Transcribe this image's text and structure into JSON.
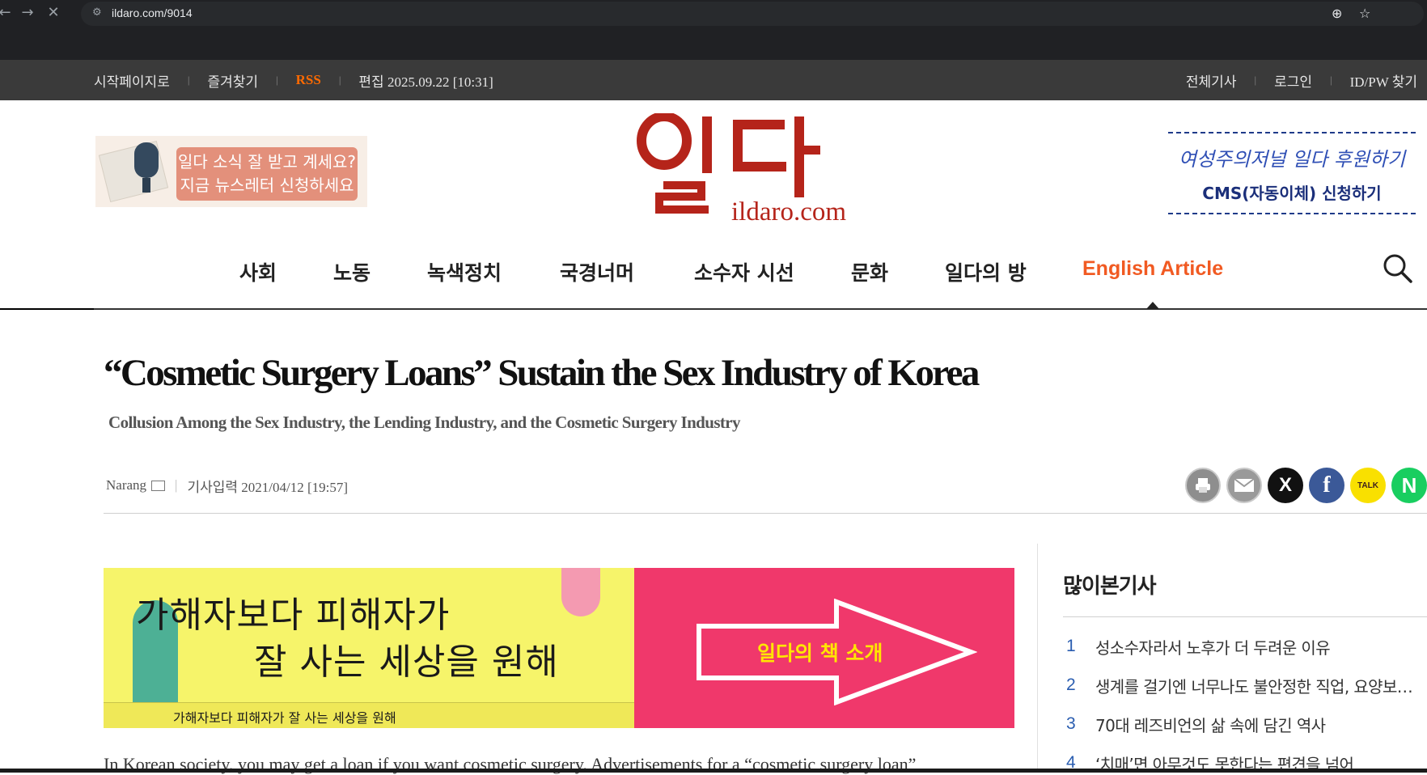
{
  "browser": {
    "url": "ildaro.com/9014"
  },
  "util_bar": {
    "left": [
      "시작페이지로",
      "즐겨찾기",
      "RSS",
      "편집 2025.09.22 [10:31]"
    ],
    "right": [
      "전체기사",
      "로그인",
      "ID/PW 찾기"
    ],
    "sep": "|"
  },
  "header": {
    "newsletter_line1": "일다 소식 잘 받고 계세요?",
    "newsletter_line2": "지금 뉴스레터 신청하세요~",
    "logo_domain": "ildaro.com",
    "cms_line1": "여성주의저널 일다 후원하기",
    "cms_line2": "CMS(자동이체) 신청하기",
    "colors": {
      "logo_red": "#b5241a",
      "accent": "#f15a22"
    }
  },
  "nav": {
    "items": [
      "사회",
      "노동",
      "녹색정치",
      "국경너머",
      "소수자 시선",
      "문화",
      "일다의 방",
      "English Article"
    ],
    "active_index": 7
  },
  "article": {
    "title": "“Cosmetic Surgery Loans” Sustain the Sex Industry of Korea",
    "subtitle": "Collusion Among the Sex Industry, the Lending Industry, and the Cosmetic Surgery Industry",
    "author": "Narang",
    "date_label": "기사입력 2021/04/12 [19:57]",
    "share": [
      "print-icon",
      "mail-icon",
      "x-icon",
      "facebook-icon",
      "kakaotalk-icon",
      "naver-icon"
    ],
    "share_labels": {
      "x": "X",
      "facebook": "f",
      "talk": "TALK",
      "naver": "N"
    },
    "body_start": "In Korean society, you may get a loan if you want cosmetic surgery. Advertisements for a “cosmetic surgery loan”"
  },
  "book_banner": {
    "title_line1": "가해자보다 피해자가",
    "title_line2": "잘 사는 세상을 원해",
    "spine": "가해자보다 피해자가 잘 사는 세상을 원해",
    "cta": "일다의 책 소개"
  },
  "sidebar": {
    "popular_title": "많이본기사",
    "items": [
      {
        "num": "1",
        "title": "성소수자라서 노후가 더 두려운 이유"
      },
      {
        "num": "2",
        "title": "생계를 걸기엔 너무나도 불안정한 직업, 요양보호사"
      },
      {
        "num": "3",
        "title": "70대 레즈비언의 삶 속에 담긴 역사"
      },
      {
        "num": "4",
        "title": "‘치매’면 아무것도 못한다는 편견을 넘어"
      }
    ]
  }
}
